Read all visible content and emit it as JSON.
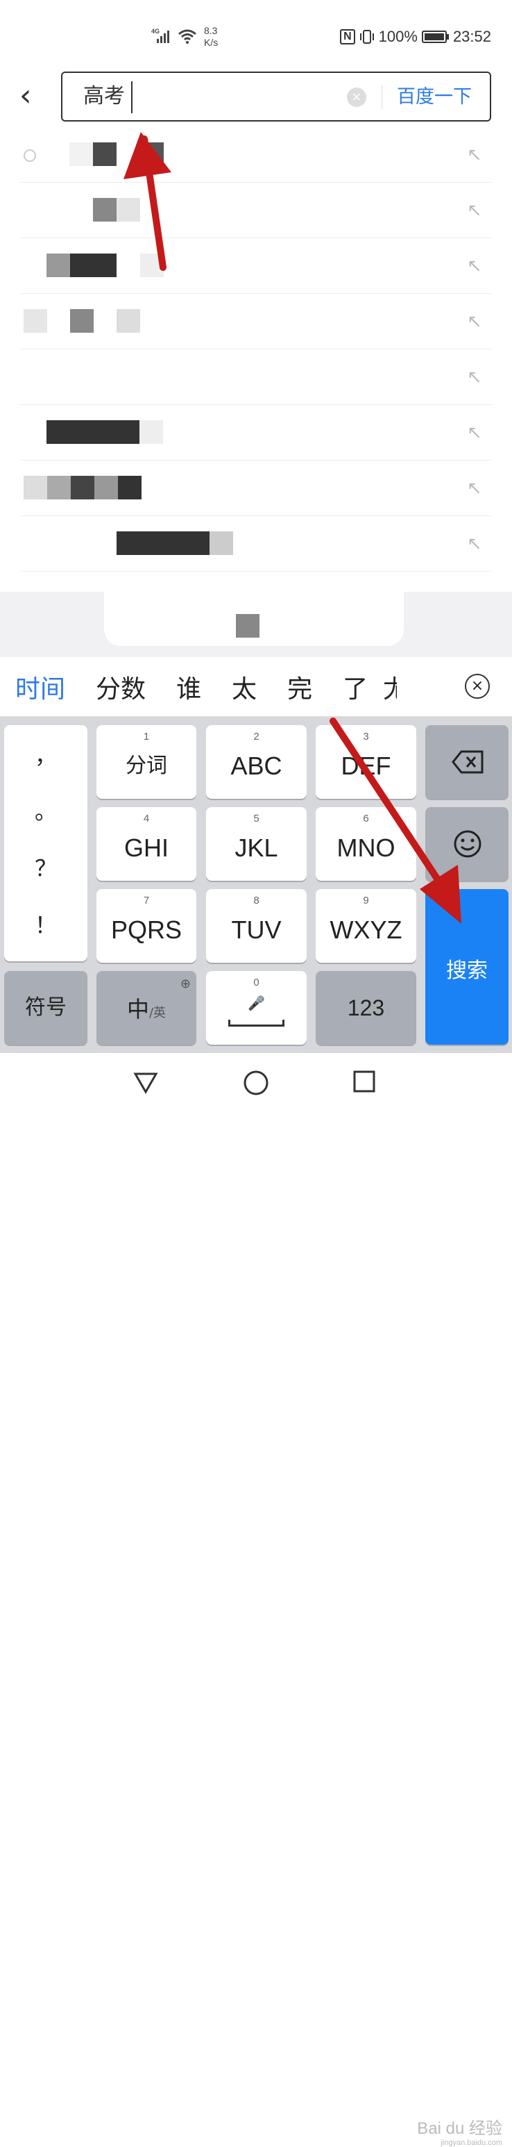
{
  "status_bar": {
    "network": "4G",
    "speed_value": "8.3",
    "speed_unit": "K/s",
    "nfc": "N",
    "battery": "100%",
    "time": "23:52"
  },
  "search": {
    "query": "高考",
    "submit_label": "百度一下"
  },
  "suggestions_count_note": "",
  "candidates": [
    "时间",
    "分数",
    "谁",
    "太",
    "完",
    "了",
    "尤"
  ],
  "keyboard": {
    "punctuation": [
      "，",
      "。",
      "？",
      "！"
    ],
    "keys": [
      {
        "num": "1",
        "label": "分词"
      },
      {
        "num": "2",
        "label": "ABC"
      },
      {
        "num": "3",
        "label": "DEF"
      },
      {
        "num": "4",
        "label": "GHI"
      },
      {
        "num": "5",
        "label": "JKL"
      },
      {
        "num": "6",
        "label": "MNO"
      },
      {
        "num": "7",
        "label": "PQRS"
      },
      {
        "num": "8",
        "label": "TUV"
      },
      {
        "num": "9",
        "label": "WXYZ"
      }
    ],
    "symbols_label": "符号",
    "lang_main": "中",
    "lang_alt": "/英",
    "space_num": "0",
    "numbers_label": "123",
    "search_label": "搜索"
  },
  "watermark": {
    "brand": "Bai du 经验",
    "url": "jingyan.baidu.com"
  },
  "colors": {
    "accent": "#2d7be5",
    "search_key": "#1a82f5",
    "annotation_arrow": "#c41a1a"
  }
}
